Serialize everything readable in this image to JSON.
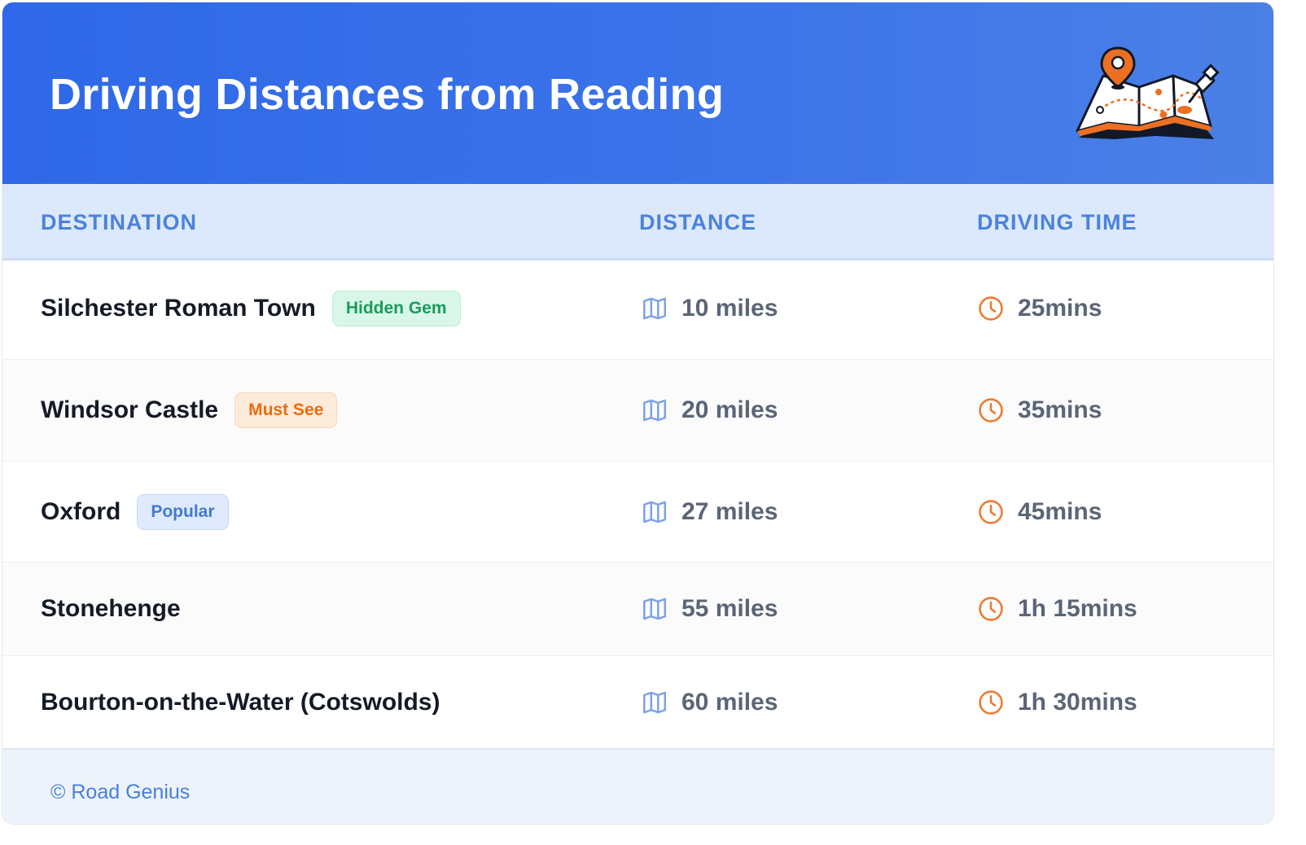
{
  "header": {
    "title": "Driving Distances from Reading"
  },
  "columns": {
    "destination": "DESTINATION",
    "distance": "DISTANCE",
    "time": "DRIVING TIME"
  },
  "rows": [
    {
      "destination": "Silchester Roman Town",
      "badge": "Hidden Gem",
      "badge_color": "#1a9c5b",
      "distance": "10 miles",
      "time": "25mins"
    },
    {
      "destination": "Windsor Castle",
      "badge": "Must See",
      "badge_color": "#ea6c10",
      "distance": "20 miles",
      "time": "35mins"
    },
    {
      "destination": "Oxford",
      "badge": "Popular",
      "badge_color": "#4479d6",
      "distance": "27 miles",
      "time": "45mins"
    },
    {
      "destination": "Stonehenge",
      "badge": null,
      "distance": "55 miles",
      "time": "1h 15mins"
    },
    {
      "destination": "Bourton-on-the-Water (Cotswolds)",
      "badge": null,
      "distance": "60 miles",
      "time": "1h 30mins"
    }
  ],
  "icons": {
    "distance": "map-icon",
    "time": "clock-icon",
    "header": "map-pin-illustration"
  },
  "footer": {
    "credit": "© Road Genius"
  },
  "colors": {
    "header_start": "#2f68e8",
    "header_end": "#4b80e6",
    "accent_orange": "#ec7a2e",
    "accent_blue": "#4b82dc"
  }
}
